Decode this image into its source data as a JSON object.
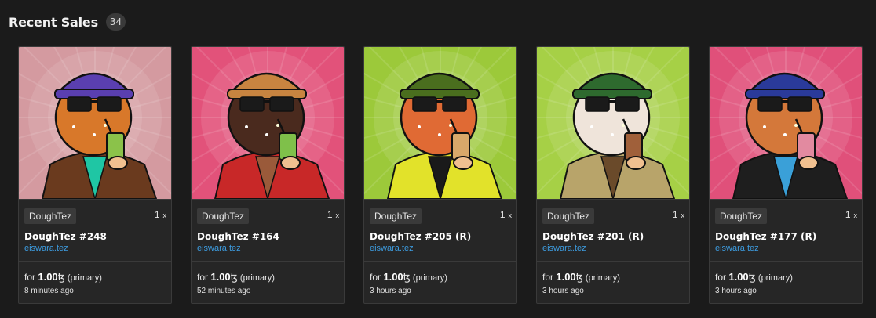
{
  "section": {
    "title": "Recent Sales",
    "count": "34"
  },
  "cards": [
    {
      "collection": "DoughTez",
      "quantity": "1",
      "quantity_suffix": "x",
      "name": "DoughTez #248",
      "creator": "eiswara.tez",
      "price_prefix": "for",
      "price": "1.00",
      "currency": "ꜩ",
      "price_note": "(primary)",
      "time": "8 minutes ago",
      "art": {
        "bg": "#d49aa0",
        "hat": "#5a3fb0",
        "shirt": "#6a3a1e",
        "donut": "#d8782a",
        "drink": "#8bc24a",
        "collar": "#1fc6a4"
      }
    },
    {
      "collection": "DoughTez",
      "quantity": "1",
      "quantity_suffix": "x",
      "name": "DoughTez #164",
      "creator": "eiswara.tez",
      "price_prefix": "for",
      "price": "1.00",
      "currency": "ꜩ",
      "price_note": "(primary)",
      "time": "52 minutes ago",
      "art": {
        "bg": "#e2527a",
        "hat": "#c88440",
        "shirt": "#c82828",
        "donut": "#4a2a1e",
        "drink": "#7fc04a",
        "collar": "#9a5a3a"
      }
    },
    {
      "collection": "DoughTez",
      "quantity": "1",
      "quantity_suffix": "x",
      "name": "DoughTez #205 (R)",
      "creator": "eiswara.tez",
      "price_prefix": "for",
      "price": "1.00",
      "currency": "ꜩ",
      "price_note": "(primary)",
      "time": "3 hours ago",
      "art": {
        "bg": "#9cc93a",
        "hat": "#4a6e1e",
        "shirt": "#e2e22a",
        "donut": "#e06a34",
        "drink": "#d9a86a",
        "collar": "#1a1a1a"
      }
    },
    {
      "collection": "DoughTez",
      "quantity": "1",
      "quantity_suffix": "x",
      "name": "DoughTez #201 (R)",
      "creator": "eiswara.tez",
      "price_prefix": "for",
      "price": "1.00",
      "currency": "ꜩ",
      "price_note": "(primary)",
      "time": "3 hours ago",
      "art": {
        "bg": "#a6d046",
        "hat": "#2e6a2e",
        "shirt": "#b8a46a",
        "donut": "#efe4da",
        "drink": "#a0603a",
        "collar": "#6a4a2a"
      }
    },
    {
      "collection": "DoughTez",
      "quantity": "1",
      "quantity_suffix": "x",
      "name": "DoughTez #177 (R)",
      "creator": "eiswara.tez",
      "price_prefix": "for",
      "price": "1.00",
      "currency": "ꜩ",
      "price_note": "(primary)",
      "time": "3 hours ago",
      "art": {
        "bg": "#e0507a",
        "hat": "#2a3a9a",
        "shirt": "#1e1e1e",
        "donut": "#d4783a",
        "drink": "#e28aa0",
        "collar": "#3aa0d8"
      }
    }
  ]
}
